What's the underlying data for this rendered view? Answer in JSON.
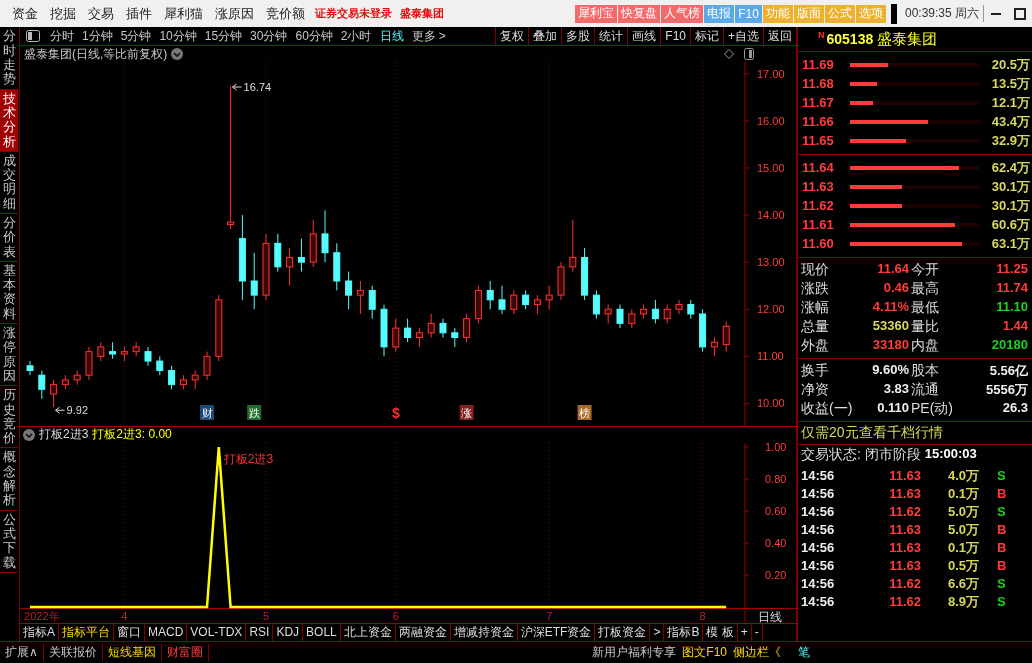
{
  "menu": [
    "资金",
    "挖掘",
    "交易",
    "插件",
    "犀利猫",
    "涨原因",
    "竞价额"
  ],
  "login_notice": "证券交易未登录",
  "stock_tag": "盛泰集团",
  "quick_buttons": [
    {
      "label": "犀利宝",
      "color": "#f26a6a"
    },
    {
      "label": "快复盘",
      "color": "#f26a6a"
    },
    {
      "label": "人气榜",
      "color": "#f26a6a"
    },
    {
      "label": "电报",
      "color": "#5aaae8"
    },
    {
      "label": "F10",
      "color": "#5aaae8"
    },
    {
      "label": "功能",
      "color": "#eeb030"
    },
    {
      "label": "版面",
      "color": "#eeb030"
    },
    {
      "label": "公式",
      "color": "#eeb030"
    },
    {
      "label": "选项",
      "color": "#eeb030"
    }
  ],
  "clock": "00:39:35 周六",
  "side_tabs": [
    {
      "label": "分时走势",
      "selected": false
    },
    {
      "label": "技术分析",
      "selected": true
    },
    {
      "label": "成交明细",
      "selected": false
    },
    {
      "label": "分价表",
      "selected": false
    },
    {
      "label": "基本资料",
      "selected": false
    },
    {
      "label": "涨停原因",
      "selected": false
    },
    {
      "label": "历史竞价",
      "selected": false
    },
    {
      "label": "概念解析",
      "selected": false
    },
    {
      "label": "公式下载",
      "selected": false
    }
  ],
  "periods": [
    {
      "label": "分时",
      "selected": false
    },
    {
      "label": "1分钟",
      "selected": false
    },
    {
      "label": "5分钟",
      "selected": false
    },
    {
      "label": "10分钟",
      "selected": false
    },
    {
      "label": "15分钟",
      "selected": false
    },
    {
      "label": "30分钟",
      "selected": false
    },
    {
      "label": "60分钟",
      "selected": false
    },
    {
      "label": "2小时",
      "selected": false
    },
    {
      "label": "日线",
      "selected": true
    }
  ],
  "more": "更多 >",
  "tools": [
    "复权",
    "叠加",
    "多股",
    "统计",
    "画线",
    "F10",
    "标记",
    "+自选",
    "返回"
  ],
  "chart_title": "盛泰集团(日线,等比前复权)",
  "price_chart": {
    "extremes": {
      "high": "16.74",
      "low": "9.92"
    },
    "event_tags": [
      {
        "label": "财",
        "kind": "tag",
        "color": "#1c4a78"
      },
      {
        "label": "跌",
        "kind": "tag",
        "color": "#1e6e2a"
      },
      {
        "label": "$",
        "kind": "mark",
        "color": "#ff3232"
      },
      {
        "label": "涨",
        "kind": "tag",
        "color": "#8a1e1e"
      },
      {
        "label": "榜",
        "kind": "tag",
        "color": "#a86a20"
      }
    ],
    "chart_data": {
      "type": "candlestick",
      "grid": true,
      "ylim": [
        9.5,
        17.25
      ],
      "yticks": [
        {
          "value": 17,
          "label": "17.00"
        },
        {
          "value": 16,
          "label": "16.00"
        },
        {
          "value": 15,
          "label": "15.00"
        },
        {
          "value": 14,
          "label": "14.00"
        },
        {
          "value": 13,
          "label": "13.00"
        },
        {
          "value": 12,
          "label": "12.00"
        },
        {
          "value": 11,
          "label": "11.00"
        },
        {
          "value": 10,
          "label": "10.00"
        }
      ],
      "categories": [
        null,
        null,
        null,
        null,
        null,
        null,
        null,
        null,
        null,
        null,
        null,
        null,
        null,
        null,
        null,
        null,
        null,
        null,
        null,
        null,
        null,
        null,
        null,
        null,
        null,
        null,
        null,
        null,
        null,
        null,
        null,
        null,
        null,
        null,
        null,
        null,
        null,
        null,
        null,
        null,
        null,
        null,
        null,
        null,
        null,
        null,
        null,
        null,
        null,
        null,
        null,
        null,
        null,
        null,
        null,
        null,
        null,
        null,
        null,
        null
      ],
      "ohlc": [
        [
          10.8,
          10.9,
          10.6,
          10.7
        ],
        [
          10.6,
          10.7,
          10.1,
          10.3
        ],
        [
          10.2,
          10.5,
          9.92,
          10.4
        ],
        [
          10.4,
          10.6,
          10.3,
          10.5
        ],
        [
          10.5,
          10.7,
          10.4,
          10.6
        ],
        [
          10.6,
          11.2,
          10.5,
          11.1
        ],
        [
          11.0,
          11.3,
          10.9,
          11.2
        ],
        [
          11.1,
          11.3,
          10.95,
          11.05
        ],
        [
          11.05,
          11.2,
          10.9,
          11.1
        ],
        [
          11.1,
          11.3,
          11.0,
          11.2
        ],
        [
          11.1,
          11.2,
          10.8,
          10.9
        ],
        [
          10.9,
          11.0,
          10.6,
          10.7
        ],
        [
          10.7,
          10.8,
          10.3,
          10.4
        ],
        [
          10.4,
          10.6,
          10.3,
          10.5
        ],
        [
          10.5,
          10.7,
          10.3,
          10.6
        ],
        [
          10.6,
          11.1,
          10.5,
          11.0
        ],
        [
          11.0,
          12.3,
          10.9,
          12.2
        ],
        [
          13.8,
          16.74,
          13.7,
          13.85
        ],
        [
          13.5,
          14.0,
          12.2,
          12.6
        ],
        [
          12.6,
          13.2,
          12.0,
          12.3
        ],
        [
          12.3,
          13.6,
          12.2,
          13.4
        ],
        [
          13.4,
          13.6,
          12.8,
          12.9
        ],
        [
          12.9,
          13.3,
          12.5,
          13.1
        ],
        [
          13.1,
          13.5,
          12.8,
          13.0
        ],
        [
          13.0,
          13.9,
          12.9,
          13.6
        ],
        [
          13.6,
          14.1,
          13.0,
          13.2
        ],
        [
          13.2,
          13.4,
          12.4,
          12.6
        ],
        [
          12.6,
          12.8,
          12.0,
          12.3
        ],
        [
          12.3,
          12.6,
          11.9,
          12.4
        ],
        [
          12.4,
          12.5,
          11.8,
          12.0
        ],
        [
          12.0,
          12.1,
          11.0,
          11.2
        ],
        [
          11.2,
          11.8,
          11.1,
          11.6
        ],
        [
          11.6,
          11.8,
          11.3,
          11.4
        ],
        [
          11.4,
          11.6,
          11.2,
          11.5
        ],
        [
          11.5,
          11.9,
          11.4,
          11.7
        ],
        [
          11.7,
          11.8,
          11.4,
          11.5
        ],
        [
          11.5,
          11.6,
          11.2,
          11.4
        ],
        [
          11.4,
          11.9,
          11.3,
          11.8
        ],
        [
          11.8,
          12.5,
          11.7,
          12.4
        ],
        [
          12.4,
          12.6,
          12.0,
          12.2
        ],
        [
          12.2,
          12.5,
          11.9,
          12.0
        ],
        [
          12.0,
          12.4,
          11.9,
          12.3
        ],
        [
          12.3,
          12.4,
          12.0,
          12.1
        ],
        [
          12.1,
          12.3,
          11.9,
          12.2
        ],
        [
          12.2,
          12.5,
          12.0,
          12.3
        ],
        [
          12.3,
          13.0,
          12.2,
          12.9
        ],
        [
          12.9,
          13.9,
          12.8,
          13.1
        ],
        [
          13.1,
          13.3,
          12.2,
          12.3
        ],
        [
          12.3,
          12.4,
          11.8,
          11.9
        ],
        [
          11.9,
          12.1,
          11.7,
          12.0
        ],
        [
          12.0,
          12.1,
          11.6,
          11.7
        ],
        [
          11.7,
          12.0,
          11.6,
          11.9
        ],
        [
          11.9,
          12.1,
          11.8,
          12.0
        ],
        [
          12.0,
          12.2,
          11.7,
          11.8
        ],
        [
          11.8,
          12.1,
          11.7,
          12.0
        ],
        [
          12.0,
          12.2,
          11.9,
          12.1
        ],
        [
          12.1,
          12.2,
          11.8,
          11.9
        ],
        [
          11.9,
          12.0,
          11.1,
          11.2
        ],
        [
          11.2,
          11.4,
          11.0,
          11.3
        ],
        [
          11.25,
          11.74,
          11.1,
          11.64
        ]
      ]
    }
  },
  "indicator": {
    "reading": "打板2进3: 0.00",
    "signal_label": "打板2进3",
    "chart_data": {
      "type": "line",
      "grid": true,
      "ylim": [
        0,
        1.025
      ],
      "yticks": [
        {
          "value": 1,
          "label": "1.00"
        },
        {
          "value": 0.8,
          "label": "0.80"
        },
        {
          "value": 0.6,
          "label": "0.60"
        },
        {
          "value": 0.4,
          "label": "0.40"
        },
        {
          "value": 0.2,
          "label": "0.20"
        }
      ],
      "categories": [
        null,
        "2022年",
        null,
        null,
        null,
        null,
        null,
        null,
        "4",
        null,
        null,
        null,
        null,
        null,
        null,
        null,
        null,
        null,
        null,
        null,
        "5",
        null,
        null,
        null,
        null,
        null,
        null,
        null,
        null,
        null,
        null,
        "6",
        null,
        null,
        null,
        null,
        null,
        null,
        null,
        null,
        null,
        null,
        null,
        null,
        "7",
        null,
        null,
        null,
        null,
        null,
        null,
        null,
        null,
        null,
        null,
        null,
        null,
        "8",
        null,
        null
      ],
      "series": [
        {
          "name": "打板2进3",
          "color": "#ffff00",
          "values": [
            0,
            0,
            0,
            0,
            0,
            0,
            0,
            0,
            0,
            0,
            0,
            0,
            0,
            0,
            0,
            0,
            1,
            0,
            0,
            0,
            0,
            0,
            0,
            0,
            0,
            0,
            0,
            0,
            0,
            0,
            0,
            0,
            0,
            0,
            0,
            0,
            0,
            0,
            0,
            0,
            0,
            0,
            0,
            0,
            0,
            0,
            0,
            0,
            0,
            0,
            0,
            0,
            0,
            0,
            0,
            0,
            0,
            0,
            0,
            0
          ]
        }
      ]
    }
  },
  "period_label": "日线",
  "indicator_tabs": [
    {
      "label": "指标A",
      "selected": false
    },
    {
      "label": "指标平台",
      "selected": true
    },
    {
      "label": "窗口",
      "selected": false
    },
    {
      "label": "MACD",
      "selected": false
    },
    {
      "label": "VOL-TDX",
      "selected": false
    },
    {
      "label": "RSI",
      "selected": false
    },
    {
      "label": "KDJ",
      "selected": false
    },
    {
      "label": "BOLL",
      "selected": false
    },
    {
      "label": "北上资金",
      "selected": false
    },
    {
      "label": "两融资金",
      "selected": false
    },
    {
      "label": "增减持资金",
      "selected": false
    },
    {
      "label": "沪深ETF资金",
      "selected": false
    },
    {
      "label": "打板资金",
      "selected": false
    },
    {
      "label": ">",
      "selected": false
    },
    {
      "label": "指标B",
      "selected": false
    },
    {
      "label": "模 板",
      "selected": false
    },
    {
      "label": "+",
      "selected": false
    },
    {
      "label": "-",
      "selected": false
    }
  ],
  "status_links": [
    {
      "label": "扩展∧",
      "kind": "plain"
    },
    {
      "label": "关联报价",
      "kind": "plain"
    },
    {
      "label": "短线基因",
      "kind": "highlight"
    },
    {
      "label": "财富圈",
      "kind": "alert"
    }
  ],
  "promo_links": [
    {
      "label": "新用户福利专享",
      "kind": "plain"
    },
    {
      "label": "图文F10",
      "kind": "highlight"
    },
    {
      "label": "侧边栏《",
      "kind": "highlight"
    }
  ],
  "detail_tab": "笔",
  "quote": {
    "badge": "N",
    "code": "605138",
    "name": "盛泰集团",
    "asks": [
      {
        "price": "11.69",
        "volume": "20.5万",
        "level": 0.29
      },
      {
        "price": "11.68",
        "volume": "13.5万",
        "level": 0.21
      },
      {
        "price": "11.67",
        "volume": "12.1万",
        "level": 0.18
      },
      {
        "price": "11.66",
        "volume": "43.4万",
        "level": 0.6
      },
      {
        "price": "11.65",
        "volume": "32.9万",
        "level": 0.43
      }
    ],
    "bids": [
      {
        "price": "11.64",
        "volume": "62.4万",
        "level": 0.84
      },
      {
        "price": "11.63",
        "volume": "30.1万",
        "level": 0.4
      },
      {
        "price": "11.62",
        "volume": "30.1万",
        "level": 0.4
      },
      {
        "price": "11.61",
        "volume": "60.6万",
        "level": 0.81
      },
      {
        "price": "11.60",
        "volume": "63.1万",
        "level": 0.86
      }
    ],
    "stats": [
      {
        "label": "现价",
        "value": "11.64",
        "kind": "up"
      },
      {
        "label": "今开",
        "value": "11.25",
        "kind": "up"
      },
      {
        "label": "涨跌",
        "value": "0.46",
        "kind": "up"
      },
      {
        "label": "最高",
        "value": "11.74",
        "kind": "up"
      },
      {
        "label": "涨幅",
        "value": "4.11%",
        "kind": "up"
      },
      {
        "label": "最低",
        "value": "11.10",
        "kind": "down"
      },
      {
        "label": "总量",
        "value": "53360",
        "kind": "volume"
      },
      {
        "label": "量比",
        "value": "1.44",
        "kind": "up"
      },
      {
        "label": "外盘",
        "value": "33180",
        "kind": "up"
      },
      {
        "label": "内盘",
        "value": "20180",
        "kind": "down"
      }
    ],
    "fundamentals": [
      {
        "label": "换手",
        "value": "9.60%"
      },
      {
        "label": "股本",
        "value": "5.56亿"
      },
      {
        "label": "净资",
        "value": "3.83"
      },
      {
        "label": "流通",
        "value": "5556万"
      },
      {
        "label": "收益(一)",
        "value": "0.110"
      },
      {
        "label": "PE(动)",
        "value": "26.3"
      }
    ],
    "promo": "仅需20元查看千档行情",
    "status_label": "交易状态: 闭市阶段",
    "status_time": "15:00:03",
    "trades": [
      {
        "time": "14:56",
        "price": "11.63",
        "volume": "4.0万",
        "side": "S",
        "kind": "sell"
      },
      {
        "time": "14:56",
        "price": "11.63",
        "volume": "0.1万",
        "side": "B",
        "kind": "buy"
      },
      {
        "time": "14:56",
        "price": "11.62",
        "volume": "5.0万",
        "side": "S",
        "kind": "sell"
      },
      {
        "time": "14:56",
        "price": "11.63",
        "volume": "5.0万",
        "side": "B",
        "kind": "buy"
      },
      {
        "time": "14:56",
        "price": "11.63",
        "volume": "0.1万",
        "side": "B",
        "kind": "buy"
      },
      {
        "time": "14:56",
        "price": "11.63",
        "volume": "0.5万",
        "side": "B",
        "kind": "buy"
      },
      {
        "time": "14:56",
        "price": "11.62",
        "volume": "6.6万",
        "side": "S",
        "kind": "sell"
      },
      {
        "time": "14:56",
        "price": "11.62",
        "volume": "8.9万",
        "side": "S",
        "kind": "sell"
      }
    ]
  }
}
